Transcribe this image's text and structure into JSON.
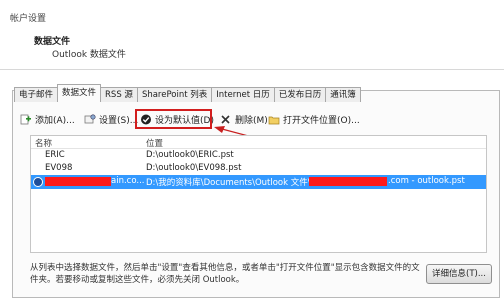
{
  "window": {
    "title": "帐户设置"
  },
  "header": {
    "title": "数据文件",
    "subtitle": "Outlook 数据文件"
  },
  "tabs": [
    {
      "label": "电子邮件",
      "active": false
    },
    {
      "label": "数据文件",
      "active": true
    },
    {
      "label": "RSS 源",
      "active": false
    },
    {
      "label": "SharePoint 列表",
      "active": false
    },
    {
      "label": "Internet 日历",
      "active": false
    },
    {
      "label": "已发布日历",
      "active": false
    },
    {
      "label": "通讯簿",
      "active": false
    }
  ],
  "toolbar": {
    "add_label": "添加(A)...",
    "settings_label": "设置(S)...",
    "set_default_label": "设为默认值(D)",
    "delete_label": "删除(M)",
    "open_location_label": "打开文件位置(O)..."
  },
  "table": {
    "columns": [
      "名称",
      "位置"
    ],
    "rows": [
      {
        "name": "ERIC",
        "location": "D:\\outlook0\\ERIC.pst",
        "selected": false
      },
      {
        "name": "EV098",
        "location": "D:\\outlook0\\EV098.pst",
        "selected": false
      },
      {
        "name": "ain.co...",
        "location": "D:\\我的资料库\\Documents\\Outlook 文件\\",
        "location_tail": ".com - outlook.pst",
        "selected": true,
        "default": true
      }
    ]
  },
  "footer": {
    "text": "从列表中选择数据文件，然后单击\"设置\"查看其他信息，或者单击\"打开文件位置\"显示包含数据文件的文件夹。若要移动或复制这些文件，必须先关闭 Outlook。",
    "details_button": "详细信息(T)..."
  },
  "colors": {
    "highlight": "#d21e1e",
    "selection": "#3399ff",
    "redaction": "#ff1a1a"
  }
}
